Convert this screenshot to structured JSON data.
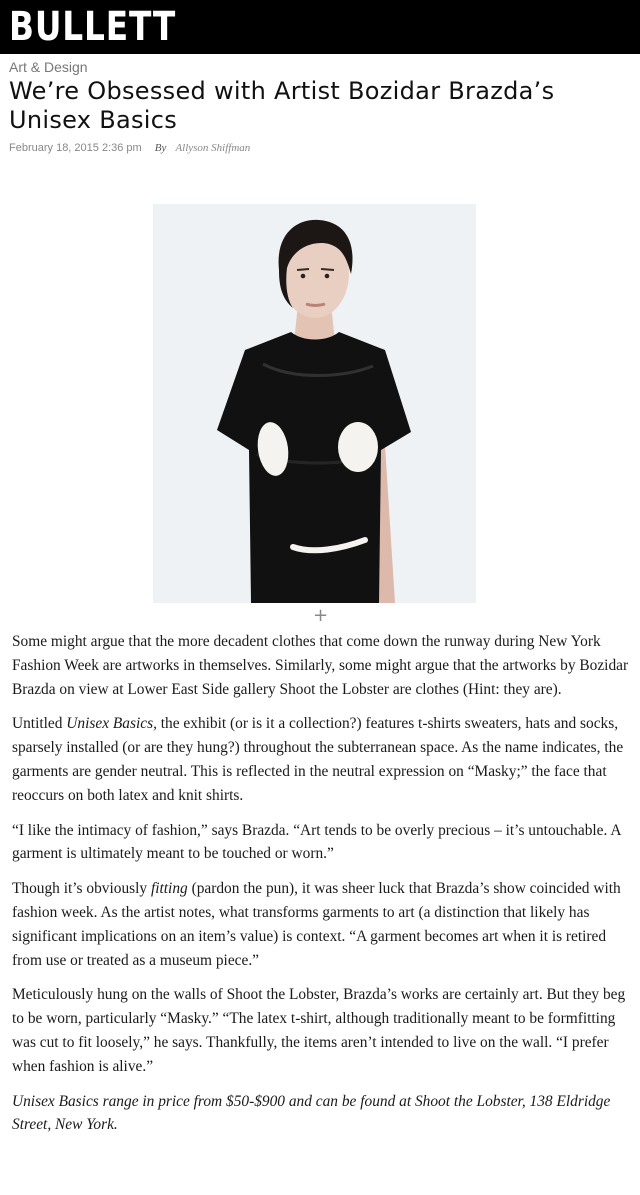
{
  "header": {
    "logo": "BULLETT"
  },
  "article": {
    "category": "Art & Design",
    "title": "We’re Obsessed with Artist Bozidar Brazda’s Unisex Basics",
    "date": "February 18, 2015 2:36 pm",
    "by_label": "By",
    "author": "Allyson Shiffman",
    "expand_icon": "plus-icon",
    "expand_glyph": "+",
    "paragraphs": {
      "p1": "Some might argue that the more decadent clothes that come down the runway during New York Fashion Week are artworks in themselves. Similarly, some might argue that the artworks by Bozidar Brazda on view at Lower East Side gallery Shoot the Lobster are clothes (Hint: they are).",
      "p2_a": "Untitled ",
      "p2_em": "Unisex Basics,",
      "p2_b": " the exhibit (or is it a collection?) features t-shirts sweaters, hats and socks, sparsely installed (or are they hung?) throughout the subterranean space. As the name indicates, the garments are gender neutral. This is reflected in the neutral expression on “Masky;” the face that reoccurs on both latex and knit shirts.",
      "p3": "“I like the intimacy of fashion,” says Brazda. “Art tends to be overly precious – it’s untouchable. A garment is ultimately meant to be touched or worn.”",
      "p4_a": "Though it’s obviously ",
      "p4_em": "fitting",
      "p4_b": " (pardon the pun), it was sheer luck that Brazda’s show coincided with fashion week. As the artist notes, what transforms garments to art (a distinction that likely has significant implications on an item’s value) is context. “A garment becomes art when it is retired from use or treated as a museum piece.”",
      "p5": "Meticulously hung on the walls of Shoot the Lobster, Brazda’s works are certainly art. But they beg to be worn, particularly “Masky.” “The latex t-shirt, although traditionally meant to be formfitting was cut to fit loosely,” he says. Thankfully, the items aren’t intended to live on the wall. “I prefer when fashion is alive.”",
      "p6": "Unisex Basics range in price from $50-$900 and can be found at Shoot the Lobster, 138 Eldridge Street, New York."
    }
  },
  "colors": {
    "topbar": "#000000",
    "text": "#1a1a1a",
    "muted": "#888888"
  }
}
